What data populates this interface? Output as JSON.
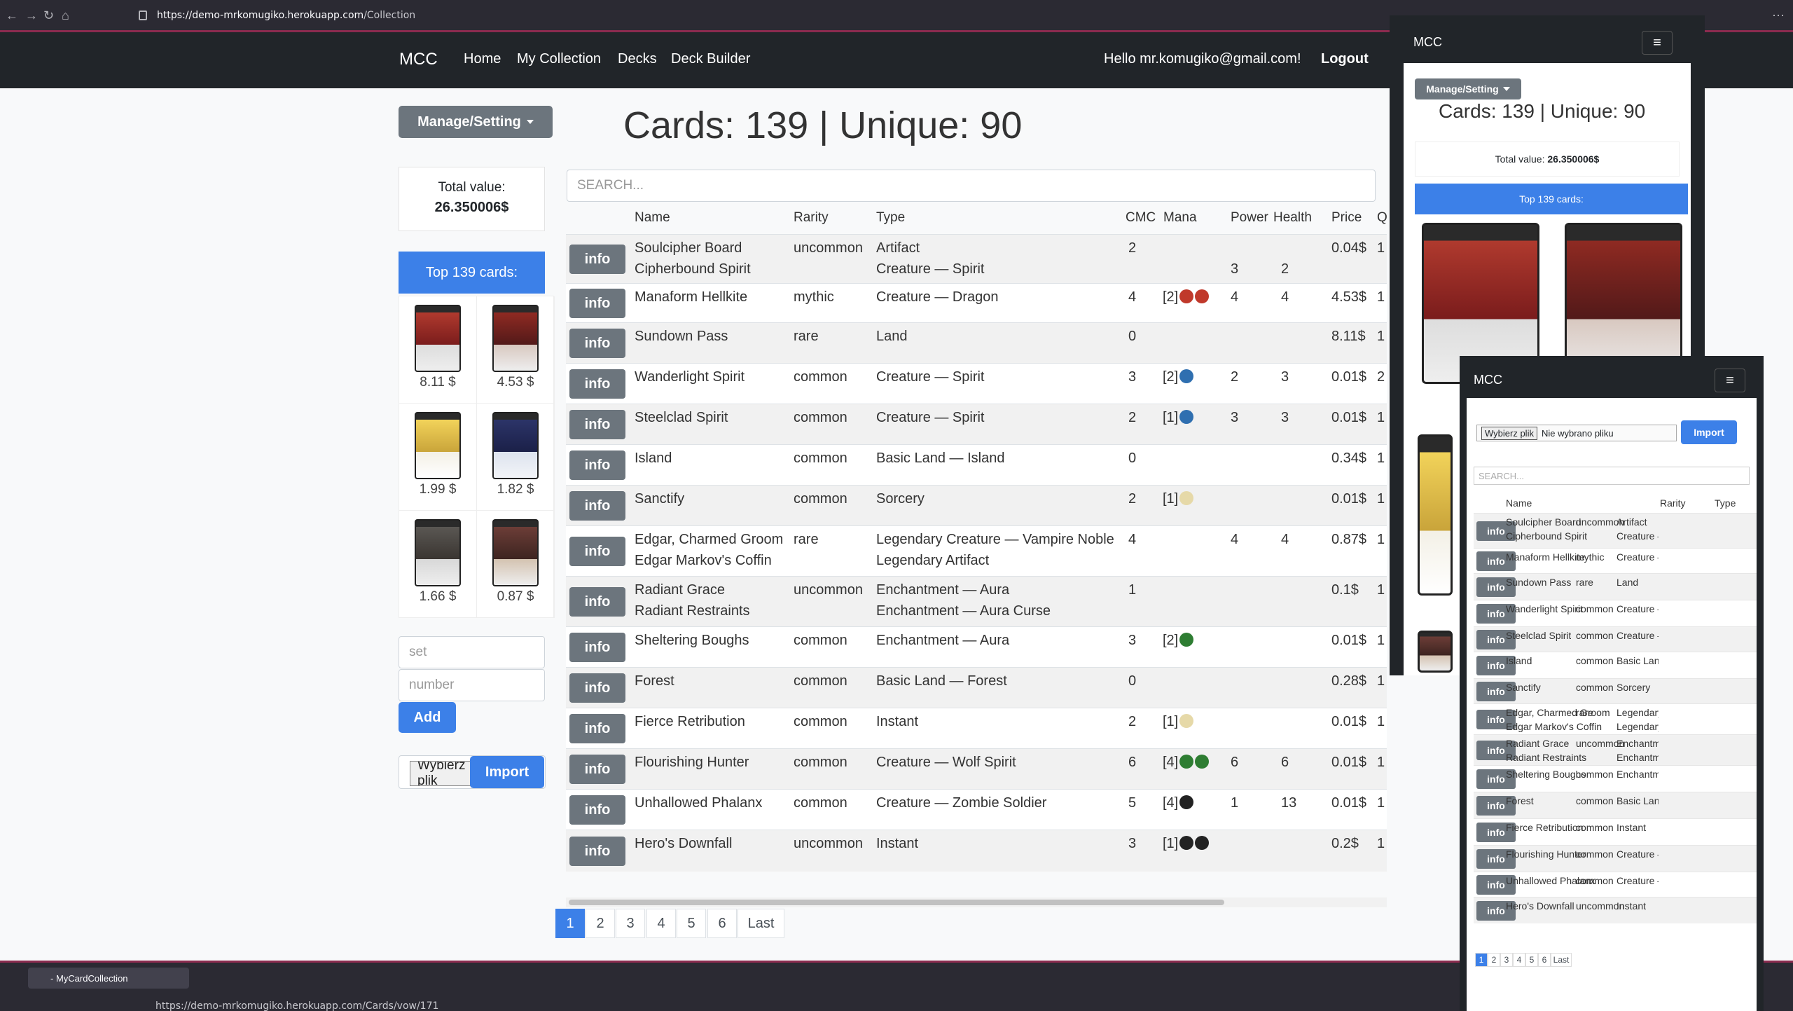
{
  "browser": {
    "url_prefix": "https://",
    "url_host": "demo-mrkomugiko.herokuapp.com",
    "url_path": "/Collection",
    "tab_title": "- MyCardCollection",
    "url2": "https://demo-mrkomugiko.herokuapp.com/Cards/vow/171"
  },
  "nav": {
    "brand": "MCC",
    "links": [
      "Home",
      "My Collection",
      "Decks",
      "Deck Builder"
    ],
    "greeting": "Hello mr.komugiko@gmail.com!",
    "logout": "Logout"
  },
  "manage_label": "Manage/Setting",
  "heading": "Cards: 139 | Unique: 90",
  "total": {
    "label": "Total value:",
    "value": "26.350006$"
  },
  "top_label": "Top 139 cards:",
  "thumbs": [
    {
      "price": "8.11 $",
      "color": "red"
    },
    {
      "price": "4.53 $",
      "color": "red2"
    },
    {
      "price": "1.99 $",
      "color": "white"
    },
    {
      "price": "1.82 $",
      "color": "blue"
    },
    {
      "price": "1.66 $",
      "color": "black"
    },
    {
      "price": "0.87 $",
      "color": "multi"
    }
  ],
  "add_form": {
    "set_placeholder": "set",
    "number_placeholder": "number",
    "add_label": "Add",
    "file_label": "Wybierz plik",
    "import_label": "Import"
  },
  "search_placeholder": "SEARCH...",
  "columns": [
    "Name",
    "Rarity",
    "Type",
    "CMC",
    "Mana",
    "Power",
    "Health",
    "Price",
    "Q"
  ],
  "info_label": "info",
  "rows": [
    {
      "name": [
        "Soulcipher Board",
        "Cipherbound Spirit"
      ],
      "rarity": "uncommon",
      "type": [
        "Artifact",
        "Creature — Spirit"
      ],
      "cmc": "2",
      "mana": "",
      "symbols": [],
      "power": [
        "",
        "3"
      ],
      "health": [
        "",
        "2"
      ],
      "price": "0.04$",
      "qty": "1"
    },
    {
      "name": [
        "Manaform Hellkite"
      ],
      "rarity": "mythic",
      "type": [
        "Creature — Dragon"
      ],
      "cmc": "4",
      "mana": "[2]",
      "symbols": [
        "red",
        "red"
      ],
      "power": [
        "4"
      ],
      "health": [
        "4"
      ],
      "price": "4.53$",
      "qty": "1"
    },
    {
      "name": [
        "Sundown Pass"
      ],
      "rarity": "rare",
      "type": [
        "Land"
      ],
      "cmc": "0",
      "mana": "",
      "symbols": [],
      "power": [
        ""
      ],
      "health": [
        ""
      ],
      "price": "8.11$",
      "qty": "1"
    },
    {
      "name": [
        "Wanderlight Spirit"
      ],
      "rarity": "common",
      "type": [
        "Creature — Spirit"
      ],
      "cmc": "3",
      "mana": "[2]",
      "symbols": [
        "blue"
      ],
      "power": [
        "2"
      ],
      "health": [
        "3"
      ],
      "price": "0.01$",
      "qty": "2"
    },
    {
      "name": [
        "Steelclad Spirit"
      ],
      "rarity": "common",
      "type": [
        "Creature — Spirit"
      ],
      "cmc": "2",
      "mana": "[1]",
      "symbols": [
        "blue"
      ],
      "power": [
        "3"
      ],
      "health": [
        "3"
      ],
      "price": "0.01$",
      "qty": "1"
    },
    {
      "name": [
        "Island"
      ],
      "rarity": "common",
      "type": [
        "Basic Land — Island"
      ],
      "cmc": "0",
      "mana": "",
      "symbols": [],
      "power": [
        ""
      ],
      "health": [
        ""
      ],
      "price": "0.34$",
      "qty": "1"
    },
    {
      "name": [
        "Sanctify"
      ],
      "rarity": "common",
      "type": [
        "Sorcery"
      ],
      "cmc": "2",
      "mana": "[1]",
      "symbols": [
        "white"
      ],
      "power": [
        ""
      ],
      "health": [
        ""
      ],
      "price": "0.01$",
      "qty": "1"
    },
    {
      "name": [
        "Edgar, Charmed Groom",
        "Edgar Markov's Coffin"
      ],
      "rarity": "rare",
      "type": [
        "Legendary Creature — Vampire Noble",
        "Legendary Artifact"
      ],
      "cmc": "4",
      "mana": "",
      "symbols": [],
      "power": [
        "4"
      ],
      "health": [
        "4"
      ],
      "price": "0.87$",
      "qty": "1"
    },
    {
      "name": [
        "Radiant Grace",
        "Radiant Restraints"
      ],
      "rarity": "uncommon",
      "type": [
        "Enchantment — Aura",
        "Enchantment — Aura Curse"
      ],
      "cmc": "1",
      "mana": "",
      "symbols": [],
      "power": [
        ""
      ],
      "health": [
        ""
      ],
      "price": "0.1$",
      "qty": "1"
    },
    {
      "name": [
        "Sheltering Boughs"
      ],
      "rarity": "common",
      "type": [
        "Enchantment — Aura"
      ],
      "cmc": "3",
      "mana": "[2]",
      "symbols": [
        "green"
      ],
      "power": [
        ""
      ],
      "health": [
        ""
      ],
      "price": "0.01$",
      "qty": "1"
    },
    {
      "name": [
        "Forest"
      ],
      "rarity": "common",
      "type": [
        "Basic Land — Forest"
      ],
      "cmc": "0",
      "mana": "",
      "symbols": [],
      "power": [
        ""
      ],
      "health": [
        ""
      ],
      "price": "0.28$",
      "qty": "1"
    },
    {
      "name": [
        "Fierce Retribution"
      ],
      "rarity": "common",
      "type": [
        "Instant"
      ],
      "cmc": "2",
      "mana": "[1]",
      "symbols": [
        "white"
      ],
      "power": [
        ""
      ],
      "health": [
        ""
      ],
      "price": "0.01$",
      "qty": "1"
    },
    {
      "name": [
        "Flourishing Hunter"
      ],
      "rarity": "common",
      "type": [
        "Creature — Wolf Spirit"
      ],
      "cmc": "6",
      "mana": "[4]",
      "symbols": [
        "green",
        "green"
      ],
      "power": [
        "6"
      ],
      "health": [
        "6"
      ],
      "price": "0.01$",
      "qty": "1"
    },
    {
      "name": [
        "Unhallowed Phalanx"
      ],
      "rarity": "common",
      "type": [
        "Creature — Zombie Soldier"
      ],
      "cmc": "5",
      "mana": "[4]",
      "symbols": [
        "black"
      ],
      "power": [
        "1"
      ],
      "health": [
        "13"
      ],
      "price": "0.01$",
      "qty": "1"
    },
    {
      "name": [
        "Hero's Downfall"
      ],
      "rarity": "uncommon",
      "type": [
        "Instant"
      ],
      "cmc": "3",
      "mana": "[1]",
      "symbols": [
        "black",
        "black"
      ],
      "power": [
        ""
      ],
      "health": [
        ""
      ],
      "price": "0.2$",
      "qty": "1"
    }
  ],
  "pagination": [
    "1",
    "2",
    "3",
    "4",
    "5",
    "6",
    "Last"
  ],
  "mobile1": {
    "brand": "MCC",
    "manage_label": "Manage/Setting",
    "heading": "Cards: 139 | Unique: 90",
    "total_label": "Total value:",
    "total_value": "26.350006$",
    "top_label": "Top 139 cards:"
  },
  "mobile2": {
    "brand": "MCC",
    "file_label": "Wybierz plik",
    "no_file": "Nie wybrano pliku",
    "import_label": "Import",
    "search_placeholder": "SEARCH...",
    "columns": [
      "Name",
      "Rarity",
      "Type"
    ],
    "rows": [
      {
        "name": [
          "Soulcipher Board",
          "Cipherbound Spirit"
        ],
        "rarity": "uncommon",
        "type": [
          "Artifact",
          "Creature — Sp"
        ]
      },
      {
        "name": [
          "Manaform Hellkite"
        ],
        "rarity": "mythic",
        "type": [
          "Creature — Dr"
        ]
      },
      {
        "name": [
          "Sundown Pass"
        ],
        "rarity": "rare",
        "type": [
          "Land"
        ]
      },
      {
        "name": [
          "Wanderlight Spirit"
        ],
        "rarity": "common",
        "type": [
          "Creature — Sp"
        ]
      },
      {
        "name": [
          "Steelclad Spirit"
        ],
        "rarity": "common",
        "type": [
          "Creature — Sp"
        ]
      },
      {
        "name": [
          "Island"
        ],
        "rarity": "common",
        "type": [
          "Basic Land —"
        ]
      },
      {
        "name": [
          "Sanctify"
        ],
        "rarity": "common",
        "type": [
          "Sorcery"
        ]
      },
      {
        "name": [
          "Edgar, Charmed Groom",
          "Edgar Markov's Coffin"
        ],
        "rarity": "rare",
        "type": [
          "Legendary Cr",
          "Legendary Ar"
        ]
      },
      {
        "name": [
          "Radiant Grace",
          "Radiant Restraints"
        ],
        "rarity": "uncommon",
        "type": [
          "Enchantment",
          "Enchantment"
        ]
      },
      {
        "name": [
          "Sheltering Boughs"
        ],
        "rarity": "common",
        "type": [
          "Enchantment"
        ]
      },
      {
        "name": [
          "Forest"
        ],
        "rarity": "common",
        "type": [
          "Basic Land —"
        ]
      },
      {
        "name": [
          "Fierce Retribution"
        ],
        "rarity": "common",
        "type": [
          "Instant"
        ]
      },
      {
        "name": [
          "Flourishing Hunter"
        ],
        "rarity": "common",
        "type": [
          "Creature — Wo"
        ]
      },
      {
        "name": [
          "Unhallowed Phalanx"
        ],
        "rarity": "common",
        "type": [
          "Creature — Zo"
        ]
      },
      {
        "name": [
          "Hero's Downfall"
        ],
        "rarity": "uncommon",
        "type": [
          "Instant"
        ]
      }
    ],
    "pagination": [
      "1",
      "2",
      "3",
      "4",
      "5",
      "6",
      "Last"
    ]
  },
  "colors": {
    "primary": "#3c80e8",
    "secondary": "#6c757d",
    "dark": "#212529",
    "red": "#c0392b",
    "blue": "#2f6fb0",
    "white": "#e6d9a8",
    "green": "#2e7d32",
    "black": "#222222"
  }
}
